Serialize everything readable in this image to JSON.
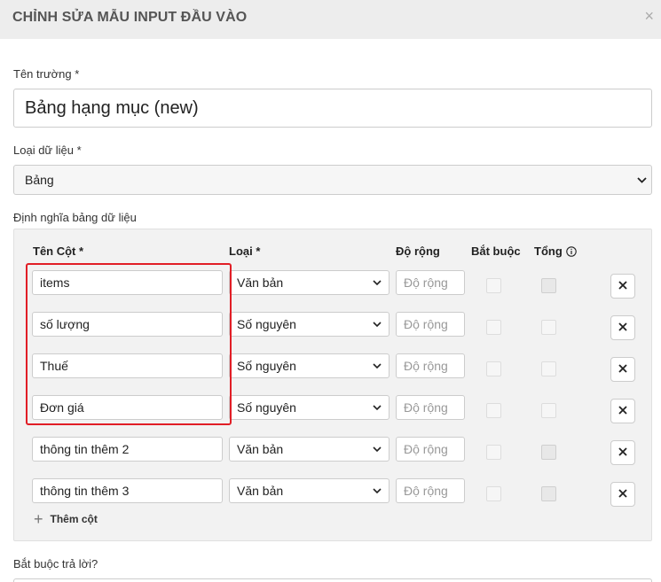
{
  "modal": {
    "title": "CHỈNH SỬA MẪU INPUT ĐẦU VÀO",
    "close": "×"
  },
  "field_name": {
    "label": "Tên trường *",
    "value": "Bảng hạng mục (new)"
  },
  "data_type": {
    "label": "Loại dữ liệu *",
    "value": "Bảng"
  },
  "table_def": {
    "label": "Định nghĩa bảng dữ liệu",
    "headers": {
      "name": "Tên Cột *",
      "type": "Loại *",
      "width": "Độ rộng",
      "required": "Bắt buộc",
      "sum": "Tổng"
    },
    "rows": [
      {
        "name": "items",
        "type": "Văn bản",
        "width_placeholder": "Độ rộng",
        "sum_disabled": true
      },
      {
        "name": "số lượng",
        "type": "Số nguyên",
        "width_placeholder": "Độ rộng",
        "sum_disabled": false
      },
      {
        "name": "Thuế",
        "type": "Số nguyên",
        "width_placeholder": "Độ rộng",
        "sum_disabled": false
      },
      {
        "name": "Đơn giá",
        "type": "Số nguyên",
        "width_placeholder": "Độ rộng",
        "sum_disabled": false
      },
      {
        "name": "thông tin thêm 2",
        "type": "Văn bản",
        "width_placeholder": "Độ rộng",
        "sum_disabled": true
      },
      {
        "name": "thông tin thêm 3",
        "type": "Văn bản",
        "width_placeholder": "Độ rộng",
        "sum_disabled": true
      }
    ],
    "add_column": "Thêm cột"
  },
  "required_answer": {
    "label": "Bắt buộc trả lời?"
  },
  "colors": {
    "highlight": "#e11e26",
    "header_bg": "#ededed"
  }
}
